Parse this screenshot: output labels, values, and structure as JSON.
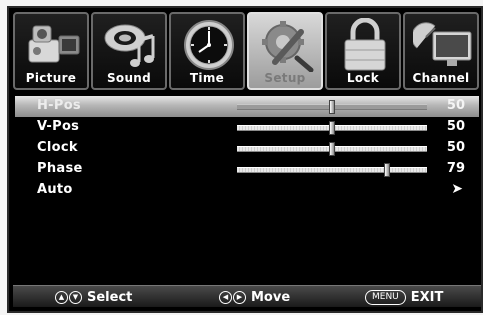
{
  "tabs": [
    {
      "label": "Picture",
      "icon": "camcorder-icon",
      "active": false
    },
    {
      "label": "Sound",
      "icon": "music-note-icon",
      "active": false
    },
    {
      "label": "Time",
      "icon": "clock-icon",
      "active": false
    },
    {
      "label": "Setup",
      "icon": "wrench-gear-icon",
      "active": true
    },
    {
      "label": "Lock",
      "icon": "padlock-icon",
      "active": false
    },
    {
      "label": "Channel",
      "icon": "satellite-tv-icon",
      "active": false
    }
  ],
  "menu": {
    "items": [
      {
        "label": "H-Pos",
        "value": "50",
        "level": 50,
        "type": "slider",
        "selected": true
      },
      {
        "label": "V-Pos",
        "value": "50",
        "level": 50,
        "type": "slider",
        "selected": false
      },
      {
        "label": "Clock",
        "value": "50",
        "level": 50,
        "type": "slider",
        "selected": false
      },
      {
        "label": "Phase",
        "value": "79",
        "level": 79,
        "type": "slider",
        "selected": false
      },
      {
        "label": "Auto",
        "type": "submenu",
        "selected": false
      }
    ]
  },
  "footer": {
    "select_label": "Select",
    "move_label": "Move",
    "menu_key": "MENU",
    "exit_label": "EXIT"
  },
  "colors": {
    "background": "#000000",
    "selected_row": "#b5b5b5",
    "text": "#ffffff",
    "active_tab_label": "#7a7a7a"
  }
}
